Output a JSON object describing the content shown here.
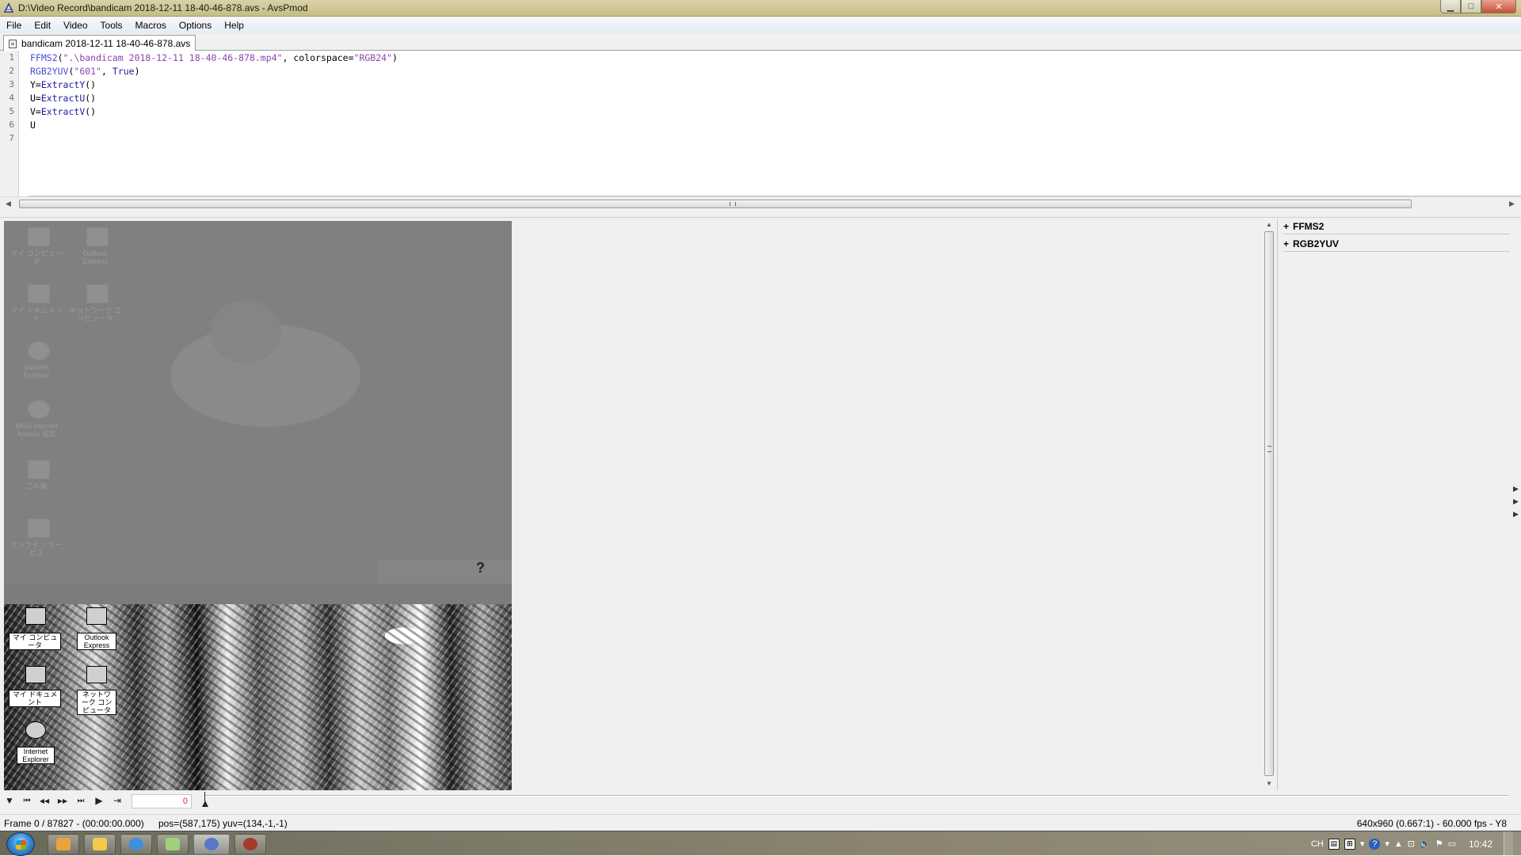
{
  "window": {
    "title": "D:\\Video Record\\bandicam 2018-12-11 18-40-46-878.avs - AvsPmod",
    "buttons": {
      "minimize": "▁",
      "maximize": "□",
      "close": "✕"
    }
  },
  "menubar": {
    "items": [
      "File",
      "Edit",
      "Video",
      "Tools",
      "Macros",
      "Options",
      "Help"
    ]
  },
  "tabs": [
    {
      "label": "bandicam 2018-12-11 18-40-46-878.avs",
      "active": true
    }
  ],
  "editor": {
    "line_numbers": [
      "1",
      "2",
      "3",
      "4",
      "5",
      "6",
      "7"
    ],
    "lines": [
      {
        "fn": "FFMS2",
        "open": "(",
        "str": "\".\\bandicam 2018-12-11 18-40-46-878.mp4\"",
        "mid": ", colorspace=",
        "str2": "\"RGB24\"",
        "close": ")"
      },
      {
        "fn": "RGB2YUV",
        "open": "(",
        "str": "\"601\"",
        "mid": ", ",
        "str2": "True",
        "close": ")"
      },
      {
        "var": "Y=",
        "fn": "ExtractY",
        "rest": "()"
      },
      {
        "var": "U=",
        "fn": "ExtractU",
        "rest": "()"
      },
      {
        "var": "V=",
        "fn": "ExtractV",
        "rest": "()"
      },
      {
        "var": "U"
      },
      {
        "var": ""
      }
    ]
  },
  "preview": {
    "desktop_labels_faded": [
      "マイ コンピュータ",
      "Outlook Express",
      "マイ ドキュメント",
      "ネットワーク コンピュータ",
      "Internet Explorer",
      "MSN Internet Access 設定",
      "ごみ箱",
      "オンライン サービス"
    ],
    "desktop_labels_bottom": [
      "マイ コンピュータ",
      "Outlook Express",
      "マイ ドキュメント",
      "ネットワーク コンピュータ",
      "Internet Explorer"
    ],
    "help_glyph": "?"
  },
  "filters": [
    {
      "expander": "+",
      "name": "FFMS2"
    },
    {
      "expander": "+",
      "name": "RGB2YUV"
    }
  ],
  "controls": {
    "frame_value": "0",
    "buttons": {
      "toggle_preview": "▼",
      "first": "⏮",
      "prev": "◀◀",
      "next": "▶▶",
      "last": "⏭",
      "play": "▶",
      "goto": "⇥"
    }
  },
  "statusbar": {
    "frame": "Frame 0 / 87827  -  (00:00:00.000)",
    "pos": "pos=(587,175)  yuv=(134,-1,-1)",
    "info": "640x960 (0.667:1)  -  60.000 fps  -  Y8"
  },
  "taskbar": {
    "clock": "10:42",
    "tray": {
      "lang": "CH",
      "help": "?"
    },
    "colors": {
      "app1": "#e9a33b",
      "app2": "#f2c94c",
      "app3": "#3f8ee0",
      "app4": "#9fd07a",
      "app5": "#5a77c8",
      "app6": "#a33b2a"
    }
  }
}
